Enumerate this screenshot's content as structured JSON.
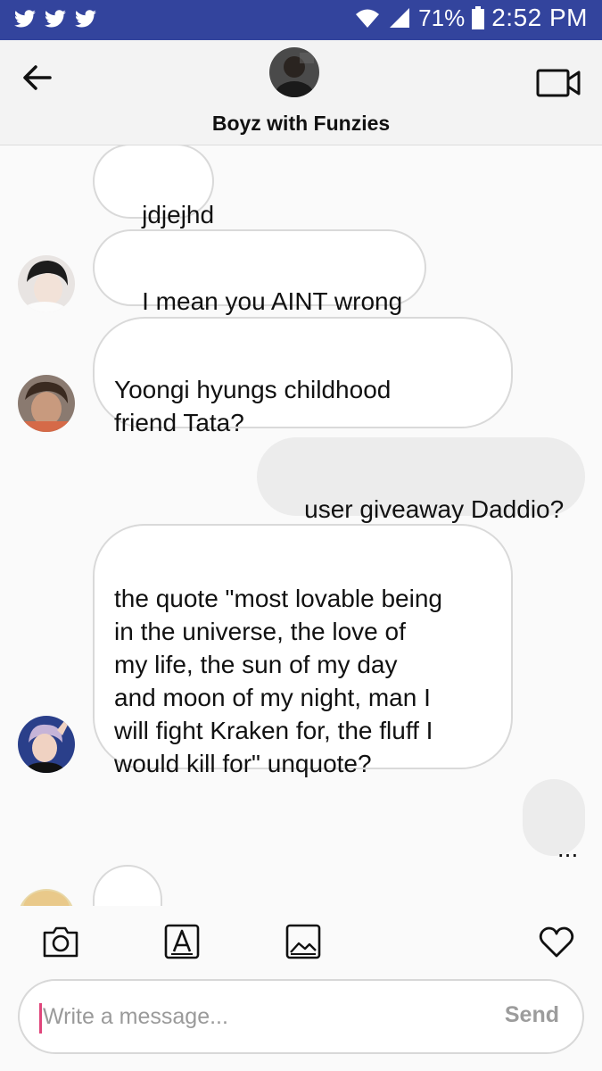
{
  "status_bar": {
    "battery": "71%",
    "time": "2:52 PM",
    "icons": [
      "twitter-icon",
      "twitter-icon",
      "twitter-icon",
      "wifi-icon",
      "signal-icon",
      "battery-icon"
    ]
  },
  "header": {
    "title": "Boyz with Funzies",
    "back_icon": "arrow-left-icon",
    "video_icon": "video-camera-icon"
  },
  "messages": [
    {
      "direction": "incoming",
      "text": "jdjejhd"
    },
    {
      "direction": "incoming",
      "text": "I mean you AINT wrong"
    },
    {
      "direction": "incoming",
      "text": "Yoongi hyungs childhood\nfriend Tata?"
    },
    {
      "direction": "outgoing",
      "text": "user giveaway Daddio?"
    },
    {
      "direction": "incoming",
      "text": "the quote \"most lovable being\nin the universe, the love of\nmy life, the sun of my day\nand moon of my night, man I\nwill fight Kraken for, the fluff I\nwould kill for\" unquote?"
    },
    {
      "direction": "outgoing",
      "text": "..."
    },
    {
      "direction": "incoming",
      "text": ""
    }
  ],
  "toolbar": {
    "tools": [
      "camera-icon",
      "text-style-icon",
      "gallery-icon",
      "heart-icon"
    ],
    "placeholder": "Write a message...",
    "send_label": "Send"
  },
  "colors": {
    "status_bar": "#33449d",
    "header_bg": "#f3f3f3",
    "incoming_bubble": "#ffffff",
    "outgoing_bubble": "#ececec",
    "cursor": "#e0457b"
  }
}
